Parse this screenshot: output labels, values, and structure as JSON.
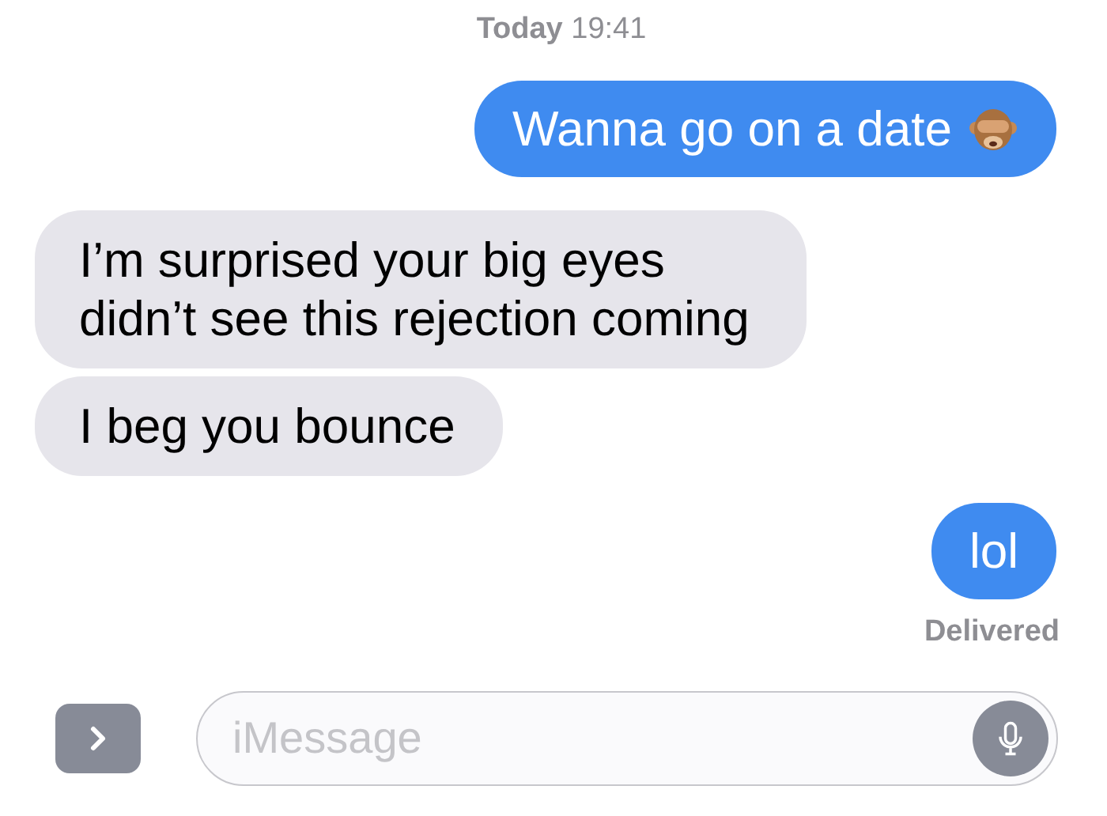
{
  "timestamp": "**Today** 19:41",
  "messages": [
    {
      "kind": "outgoing",
      "text": "Wanna go on a date",
      "emoji": true
    },
    {
      "kind": "incoming",
      "text": "I’m surprised your big eyes didn’t see this rejection coming"
    },
    {
      "kind": "incoming",
      "text": "I beg you bounce"
    },
    {
      "kind": "outgoing",
      "text": "lol"
    }
  ],
  "status": "Delivered",
  "composer": {
    "placeholder": "iMessage"
  }
}
